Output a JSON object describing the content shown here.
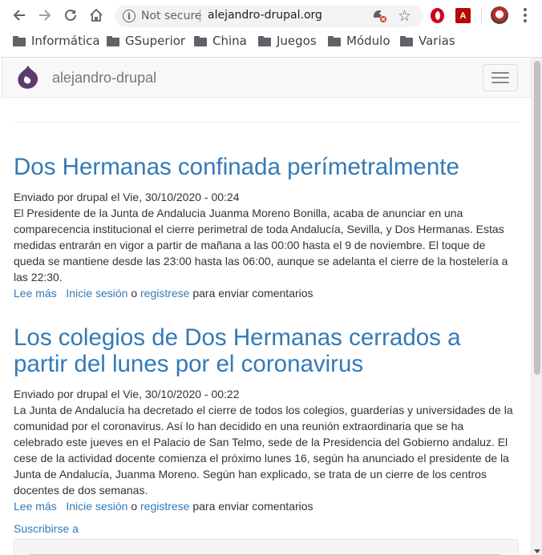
{
  "browser": {
    "security_label": "Not secure",
    "url": "alejandro-drupal.org",
    "bookmarks": [
      "Informática",
      "GSuperior",
      "China",
      "Juegos",
      "Módulo",
      "Varias"
    ],
    "extensions": [
      "opera-icon",
      "pdf-icon",
      "avatar"
    ]
  },
  "site": {
    "brand": "alejandro-drupal"
  },
  "articles": [
    {
      "title": "Dos Hermanas confinada perímetralmente",
      "submitted": "Enviado por drupal el Vie, 30/10/2020 - 00:24",
      "body": "El Presidente de la Junta de Andalucia Juanma Moreno Bonilla, acaba de anunciar en una comparecencia institucional el cierre perimetral de toda Andalucía, Sevilla, y Dos Hermanas. Estas medidas entrarán en vigor a partir de mañana a las 00:00 hasta el 9 de noviembre. El toque de queda se mantiene desde las 23:00 hasta las 06:00, aunque se adelanta el cierre de la hostelería a las 22:30.",
      "read_more": "Lee más",
      "login": "Inicie sesión",
      "or": "o",
      "register": "registrese",
      "comment_suffix": "para enviar comentarios"
    },
    {
      "title": "Los colegios de Dos Hermanas cerrados a partir del lunes por el coronavirus",
      "submitted": "Enviado por drupal el Vie, 30/10/2020 - 00:22",
      "body": "La Junta de Andalucía ha decretado el cierre de todos los colegios, guarderías y universidades de la comunidad por el coronavirus. Así lo han decidido en una reunión extraordinaria que se ha celebrado este jueves en el Palacio de San Telmo, sede de la Presidencia del Gobierno andaluz. El cese de la actividad docente comienza el próximo lunes 16, según ha anunciado el presidente de la Junta de Andalucía, Juanma Moreno. Según han explicado, se trata de un cierre de los centros docentes de dos semanas.",
      "read_more": "Lee más",
      "login": "Inicie sesión",
      "or": "o",
      "register": "registrese",
      "comment_suffix": "para enviar comentarios"
    }
  ],
  "feed_label": "Suscribirse a"
}
